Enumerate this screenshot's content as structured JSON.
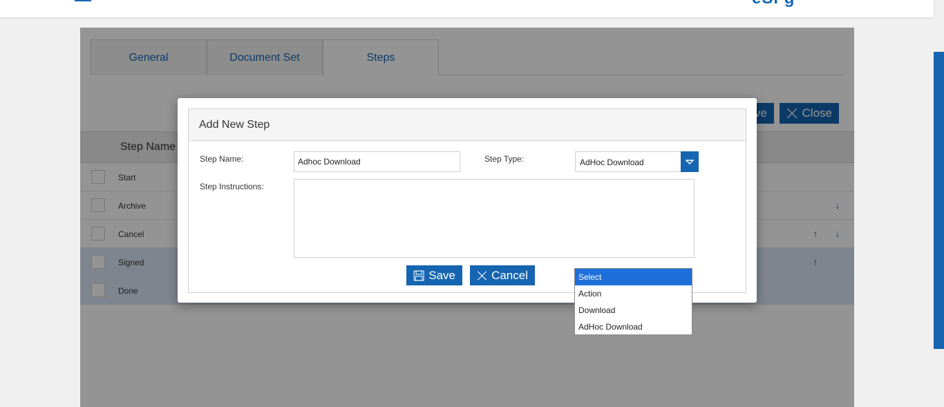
{
  "tabs": [
    {
      "label": "General"
    },
    {
      "label": "Document Set"
    },
    {
      "label": "Steps"
    }
  ],
  "toolbar": {
    "save_label": "ve",
    "close_label": "Close"
  },
  "grid": {
    "header": "Step Name",
    "rows": [
      {
        "name": "Start"
      },
      {
        "name": "Archive"
      },
      {
        "name": "Cancel"
      },
      {
        "name": "Signed"
      },
      {
        "name": "Done"
      }
    ]
  },
  "modal": {
    "title": "Add New Step",
    "step_name_label": "Step Name:",
    "step_name_value": "Adhoc Download",
    "step_type_label": "Step Type:",
    "step_type_value": "AdHoc Download",
    "instructions_label": "Step Instructions:",
    "instructions_value": "",
    "save_label": "Save",
    "cancel_label": "Cancel"
  },
  "dropdown": {
    "options": [
      "Select",
      "Action",
      "Download",
      "AdHoc Download"
    ],
    "highlighted": "Select"
  },
  "colors": {
    "accent": "#1565b0",
    "highlight": "#1e6fd9",
    "selected_row": "#dbe6f6"
  }
}
